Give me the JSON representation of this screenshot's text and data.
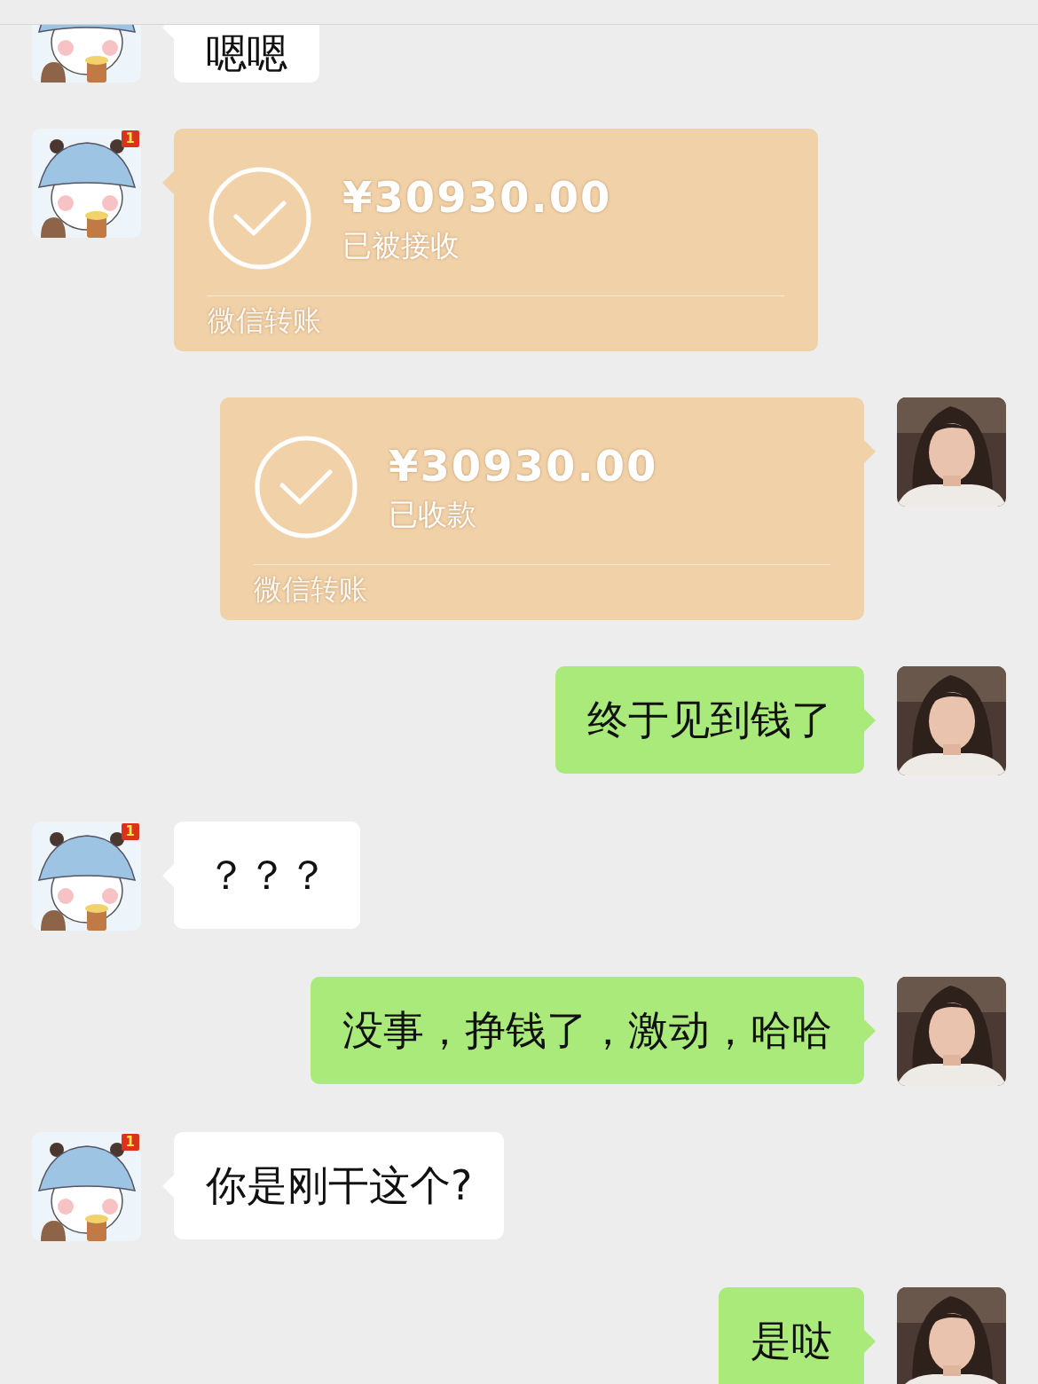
{
  "messages": [
    {
      "outgoing": false,
      "kind": "text",
      "text": "嗯嗯"
    },
    {
      "outgoing": false,
      "kind": "transfer",
      "amount": "¥30930.00",
      "status": "已被接收",
      "label": "微信转账",
      "badge": "1"
    },
    {
      "outgoing": true,
      "kind": "transfer",
      "amount": "¥30930.00",
      "status": "已收款",
      "label": "微信转账"
    },
    {
      "outgoing": true,
      "kind": "text",
      "text": "终于见到钱了"
    },
    {
      "outgoing": false,
      "kind": "text",
      "text": "？？？",
      "badge": "1"
    },
    {
      "outgoing": true,
      "kind": "text",
      "text": "没事，挣钱了，激动，哈哈"
    },
    {
      "outgoing": false,
      "kind": "text",
      "text": "你是刚干这个?",
      "badge": "1"
    },
    {
      "outgoing": true,
      "kind": "text",
      "text": "是哒"
    }
  ]
}
